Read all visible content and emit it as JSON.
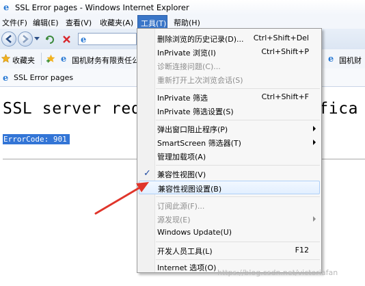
{
  "window": {
    "title": "SSL Error pages - Windows Internet Explorer"
  },
  "menubar": {
    "items": [
      {
        "label": "文件(F)"
      },
      {
        "label": "编辑(E)"
      },
      {
        "label": "查看(V)"
      },
      {
        "label": "收藏夹(A)"
      },
      {
        "label": "工具(T)"
      },
      {
        "label": "帮助(H)"
      }
    ]
  },
  "favorites": {
    "label": "收藏夹",
    "items": [
      {
        "label": "国机财务有限责任公"
      },
      {
        "label": "国机财"
      }
    ]
  },
  "tab": {
    "label": "SSL Error pages"
  },
  "page": {
    "heading": "SSL server requires client certifica",
    "error_code": "ErrorCode: 901"
  },
  "tools_menu": {
    "items": [
      {
        "label": "删除浏览的历史记录(D)...",
        "shortcut": "Ctrl+Shift+Del"
      },
      {
        "label": "InPrivate 浏览(I)",
        "shortcut": "Ctrl+Shift+P"
      },
      {
        "label": "诊断连接问题(C)..."
      },
      {
        "label": "重新打开上次浏览会话(S)"
      },
      {
        "label": "InPrivate 筛选",
        "shortcut": "Ctrl+Shift+F"
      },
      {
        "label": "InPrivate 筛选设置(S)"
      },
      {
        "label": "弹出窗口阻止程序(P)"
      },
      {
        "label": "SmartScreen 筛选器(T)"
      },
      {
        "label": "管理加载项(A)"
      },
      {
        "label": "兼容性视图(V)"
      },
      {
        "label": "兼容性视图设置(B)"
      },
      {
        "label": "订阅此源(F)..."
      },
      {
        "label": "源发现(E)"
      },
      {
        "label": "Windows Update(U)"
      },
      {
        "label": "开发人员工具(L)",
        "shortcut": "F12"
      },
      {
        "label": "Internet 选项(O)"
      }
    ]
  },
  "watermark": "https://blog.csdn.net/victoriafan",
  "colors": {
    "selection": "#3375d6",
    "menu_active": "#3a76c8",
    "arrow": "#e0352b"
  }
}
